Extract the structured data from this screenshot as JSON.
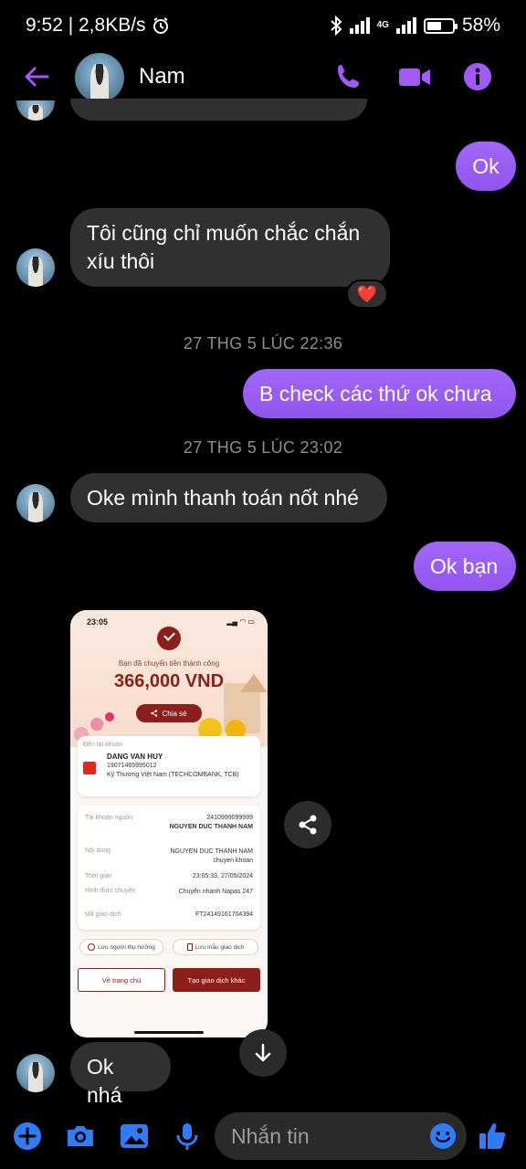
{
  "status_bar": {
    "time_speed": "9:52 | 2,8KB/s",
    "network": "4G",
    "battery": "58%",
    "battery_level": 0.58
  },
  "header": {
    "contact_name": "Nam",
    "accent_color": "#a259f7"
  },
  "messages": [
    {
      "side": "out",
      "text": "Ok"
    },
    {
      "side": "in",
      "line1": "Tôi cũng chỉ muốn chắc chắn",
      "line2": "xíu thôi",
      "reaction": "❤️"
    },
    {
      "type": "timestamp",
      "text": "27 THG 5 LÚC 22:36"
    },
    {
      "side": "out",
      "text": "B check các thứ ok chưa"
    },
    {
      "type": "timestamp",
      "text": "27 THG 5 LÚC 23:02"
    },
    {
      "side": "in",
      "text": "Oke mình thanh toán nốt nhé"
    },
    {
      "side": "out",
      "text": "Ok bạn"
    },
    {
      "side": "in",
      "text": "Ok nhá"
    }
  ],
  "receipt": {
    "time": "23:05",
    "status_icons": "▂▄ ◠ ▭",
    "subtitle": "Bạn đã chuyển tiền thành công",
    "amount": "366,000 VND",
    "share_label": "Chia sẻ",
    "to_label": "Đến tài khoản",
    "recipient_name": "DANG VAN HUY",
    "recipient_account": "19071465995012",
    "recipient_bank": "Kỹ Thương Việt Nam (TECHCOMBANK, TCB)",
    "source_label": "Tài khoản nguồn",
    "source_account": "2410999099999",
    "source_name": "NGUYEN DUC THANH NAM",
    "content_label": "Nội dung",
    "content_value": "NGUYEN DUC THANH NAM chuyen khoan",
    "time_label": "Thời gian",
    "time_value": "23:05:33, 27/05/2024",
    "method_label": "Hình thức chuyển",
    "method_value": "Chuyển nhanh Napas 247",
    "txn_label": "Mã giao dịch",
    "txn_value": "FT24149161704394",
    "save_beneficiary": "Lưu người thụ hưởng",
    "save_template": "Lưu mẫu giao dịch",
    "home_button": "Về trang chủ",
    "new_txn_button": "Tạo giao dịch khác"
  },
  "composer": {
    "placeholder": "Nhắn tin"
  }
}
